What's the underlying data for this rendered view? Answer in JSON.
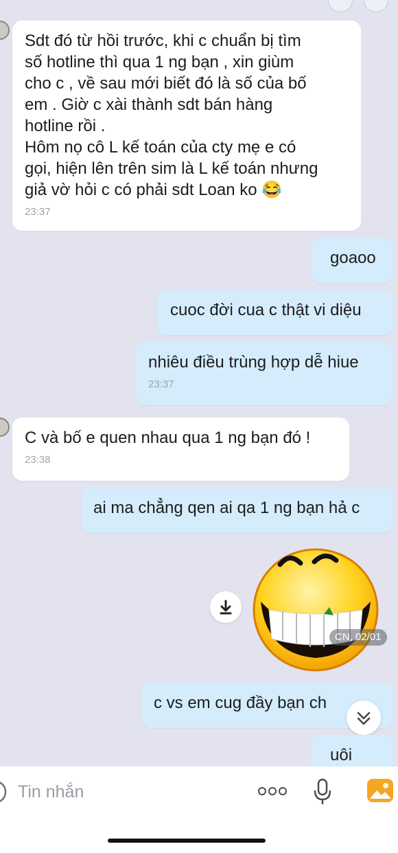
{
  "messages": [
    {
      "id": "m1",
      "direction": "in",
      "text": "Sdt đó từ hồi trước, khi c chuẩn bị tìm\nsố hotline thì qua 1 ng bạn , xin giùm\ncho c , về sau mới biết đó là số của bố\nem . Giờ c xài thành sdt bán hàng\nhotline rồi .\nHôm nọ cô L kế toán của cty mẹ e có\ngọi, hiện lên trên sim là L kế toán nhưng\ngiả vờ hỏi c có phải sdt Loan ko 😂",
      "time": "23:37"
    },
    {
      "id": "m2",
      "direction": "out",
      "text": "goaoo"
    },
    {
      "id": "m3",
      "direction": "out",
      "text": "cuoc đời cua c thật vi diệu"
    },
    {
      "id": "m4",
      "direction": "out",
      "text": "nhiêu điều trùng hợp dễ hiue",
      "time": "23:37"
    },
    {
      "id": "m5",
      "direction": "in",
      "text": "C và bố e quen nhau qua 1 ng bạn đó !",
      "time": "23:38"
    },
    {
      "id": "m6",
      "direction": "out",
      "text": "ai ma chẳng qen ai qa 1 ng bạn hả c"
    },
    {
      "id": "m7",
      "direction": "out",
      "text": "c vs em cug đầy bạn ch"
    },
    {
      "id": "m8",
      "direction": "out",
      "text": "uôi"
    }
  ],
  "sticker": {
    "icon": "grinning-emoji-sticker",
    "date_badge": "CN, 02/01"
  },
  "icons": {
    "download": "download-icon",
    "scroll_down": "chevron-double-down-icon",
    "more": "more-dots-icon",
    "mic": "microphone-icon",
    "gallery": "gallery-icon",
    "emoji": "emoji-icon"
  },
  "composer": {
    "placeholder": "Tin nhắn"
  },
  "colors": {
    "incoming": "#ffffff",
    "outgoing": "#d4ecfb",
    "background": "#e2e3ee",
    "gallery_accent": "#f5a623"
  }
}
